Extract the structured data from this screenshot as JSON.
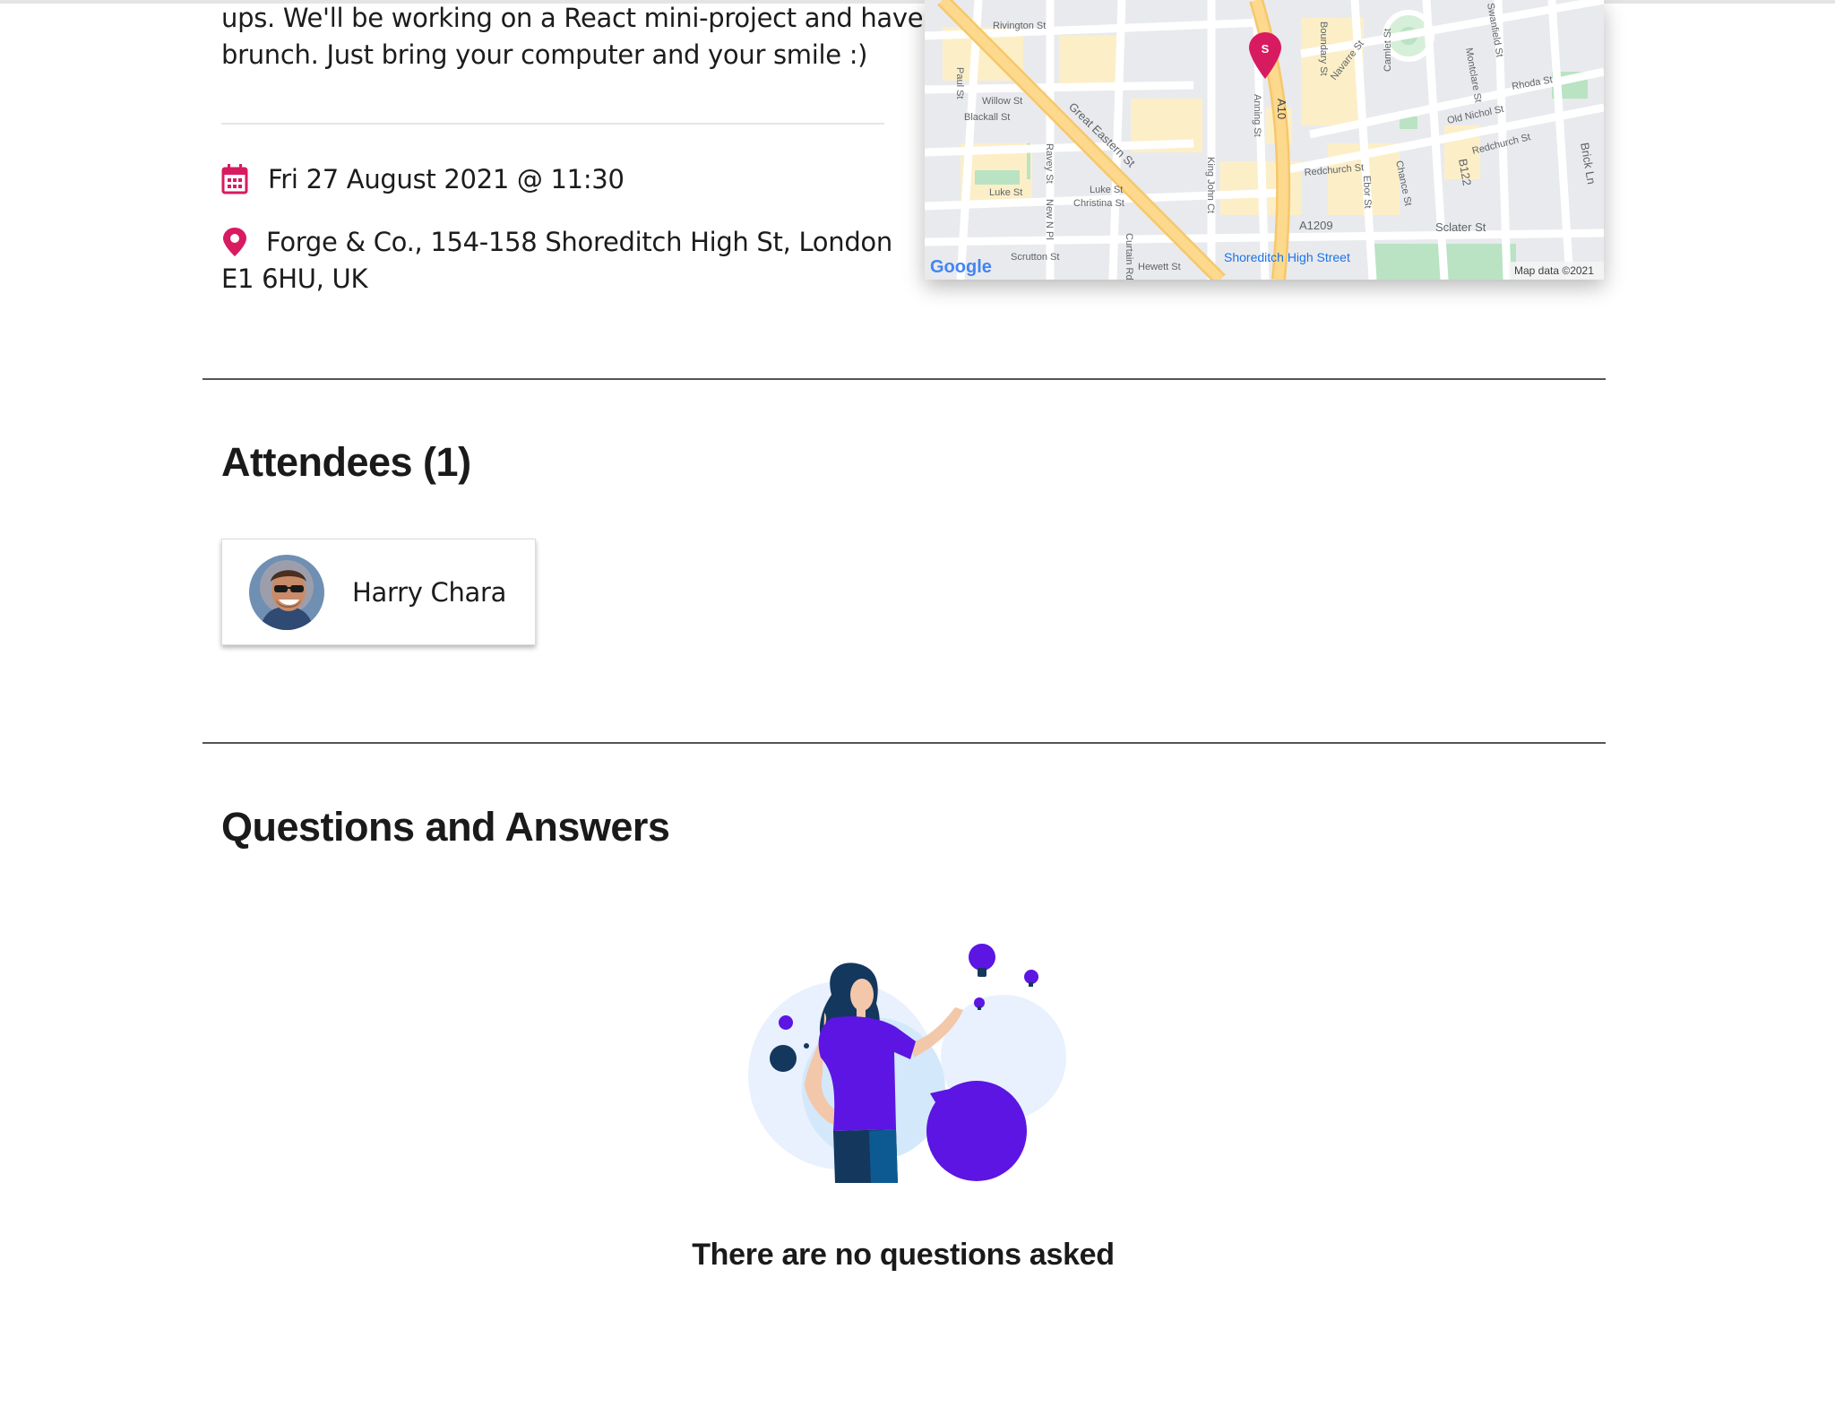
{
  "event": {
    "description_lines": [
      "ups. We'll be working on a React mini-project and have",
      "brunch. Just bring your computer and your smile :)"
    ],
    "date": "Fri 27 August 2021 @ 11:30",
    "location_lines": [
      "Forge & Co., 154-158 Shoreditch High St, London",
      "E1 6HU, UK"
    ]
  },
  "map": {
    "marker_letter": "S",
    "brand": "Google",
    "attribution": "Map data ©2021",
    "street_labels": [
      "Rivington St",
      "Willow St",
      "Blackall St",
      "Great Eastern St",
      "Luke St",
      "Luke St",
      "Christina St",
      "Scrutton St",
      "Hewett St",
      "Curtain Rd",
      "Paul St",
      "Ravey St",
      "New N Pl",
      "King John Ct",
      "Anning St",
      "A10",
      "Boundary St",
      "Navarre St",
      "Camlet St",
      "Montclare St",
      "Swanfield St",
      "Rhoda St",
      "Old Nichol St",
      "Redchurch St",
      "Redchurch St",
      "Chance St",
      "Ebor St",
      "B122",
      "Brick Ln",
      "Sclater St",
      "A1209",
      "Shoreditch High Street"
    ]
  },
  "attendees": {
    "title": "Attendees (1)",
    "list": [
      {
        "name": "Harry Chara"
      }
    ]
  },
  "qa": {
    "title": "Questions and Answers",
    "empty_message": "There are no questions asked"
  },
  "colors": {
    "accent": "#d81b60",
    "illustration_purple": "#5c15e3",
    "illustration_navy": "#14375e",
    "illustration_bg": "#e8f1fd"
  }
}
